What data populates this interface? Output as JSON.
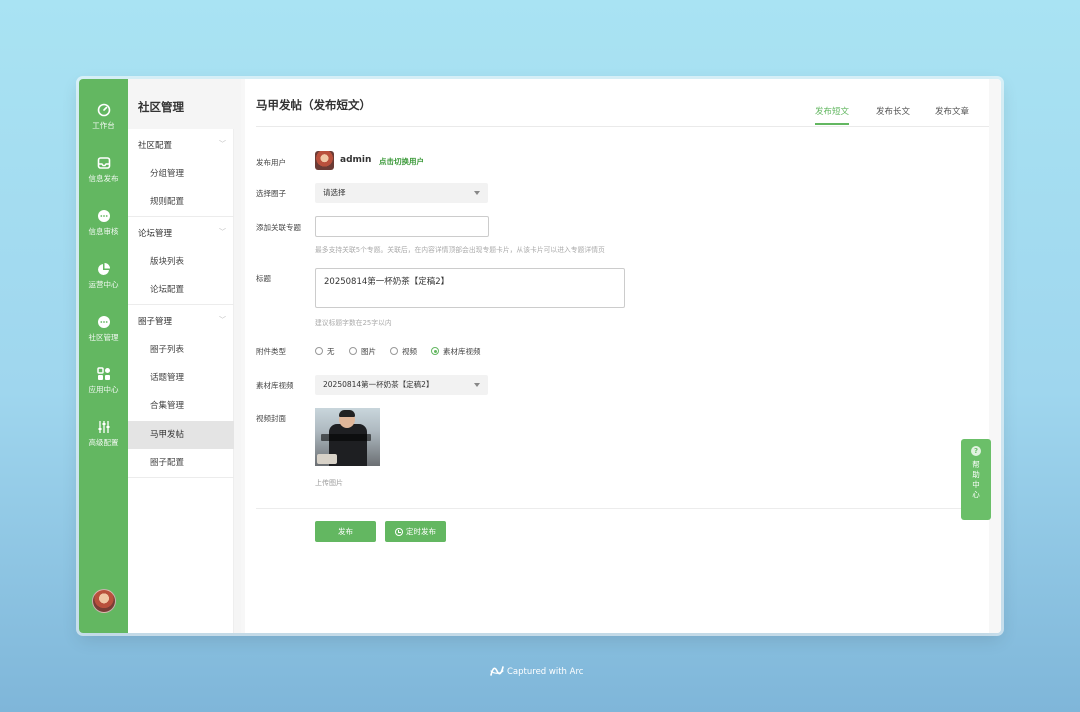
{
  "rail": {
    "items": [
      {
        "label": "工作台",
        "icon": "dashboard-icon"
      },
      {
        "label": "信息发布",
        "icon": "inbox-icon"
      },
      {
        "label": "信息审核",
        "icon": "chat-bubble-icon"
      },
      {
        "label": "运营中心",
        "icon": "pie-chart-icon"
      },
      {
        "label": "社区管理",
        "icon": "chat-bubble-icon"
      },
      {
        "label": "应用中心",
        "icon": "apps-grid-icon"
      },
      {
        "label": "高级配置",
        "icon": "sliders-icon"
      }
    ]
  },
  "submenu": {
    "title": "社区管理",
    "groups": [
      {
        "label": "社区配置",
        "items": [
          "分组管理",
          "规则配置"
        ]
      },
      {
        "label": "论坛管理",
        "items": [
          "版块列表",
          "论坛配置"
        ]
      },
      {
        "label": "圈子管理",
        "items": [
          "圈子列表",
          "话题管理",
          "合集管理",
          "马甲发帖",
          "圈子配置"
        ]
      }
    ],
    "active": "马甲发帖"
  },
  "page": {
    "title": "马甲发帖（发布短文）",
    "tabs": [
      "发布短文",
      "发布长文",
      "发布文章"
    ],
    "active_tab": "发布短文"
  },
  "form": {
    "user_label": "发布用户",
    "user_name": "admin",
    "switch_user": "点击切换用户",
    "circle_label": "选择圈子",
    "circle_value": "请选择",
    "topic_label": "添加关联专题",
    "topic_value": "",
    "topic_hint": "最多支持关联5个专题。关联后，在内容详情顶部会出现专题卡片，从该卡片可以进入专题详情页",
    "title_label": "标题",
    "title_value": "20250814第一杯奶茶【定稿2】",
    "title_hint": "建议标题字数在25字以内",
    "attach_label": "附件类型",
    "attach_options": [
      "无",
      "图片",
      "视频",
      "素材库视频"
    ],
    "attach_selected": "素材库视频",
    "library_label": "素材库视频",
    "library_value": "20250814第一杯奶茶【定稿2】",
    "cover_label": "视频封面",
    "upload_text": "上传图片"
  },
  "buttons": {
    "publish": "发布",
    "scheduled": "定时发布"
  },
  "help": {
    "label": "帮助中心"
  },
  "footer": {
    "captured": "Captured with Arc"
  },
  "colors": {
    "brand_green": "#63b761",
    "link_green": "#3f9b3d"
  }
}
